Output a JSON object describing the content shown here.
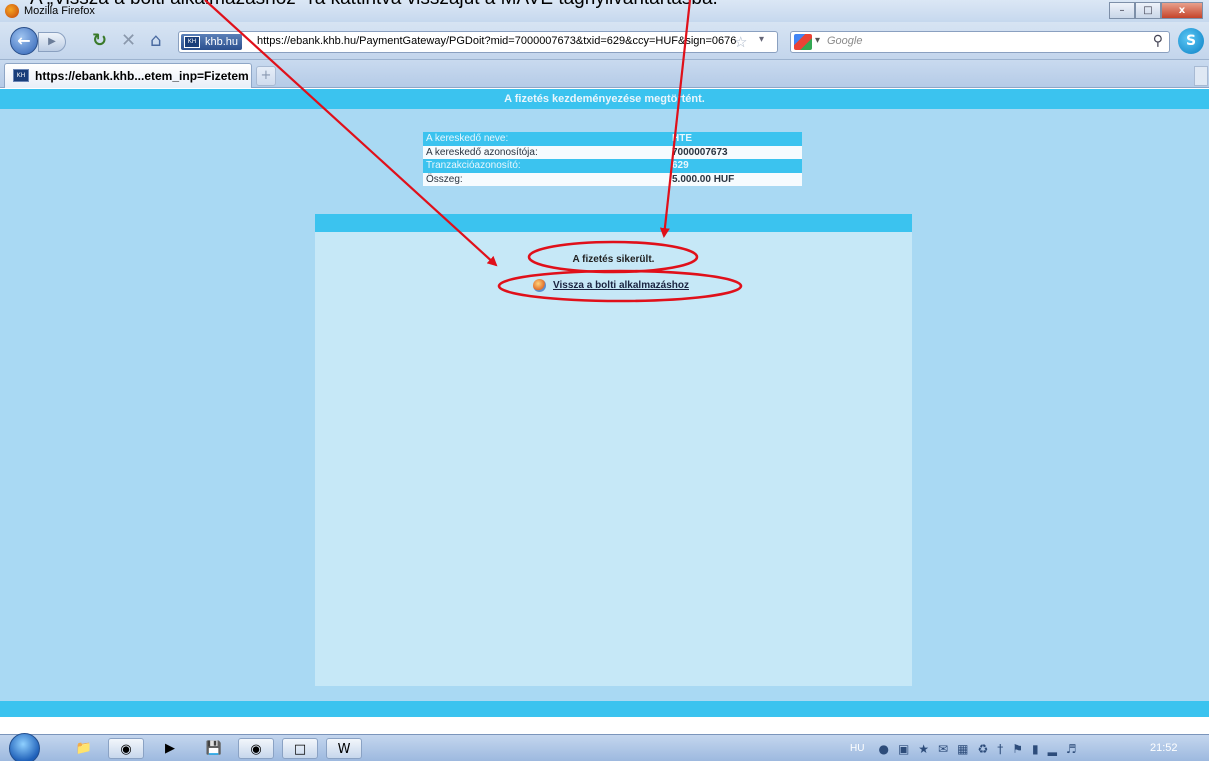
{
  "caption": "A „Vissza a bolti alkalmazáshoz”-ra kattintva visszajút a MAVE tagnyilvántartásba.",
  "window": {
    "title": "Mozilla Firefox",
    "buttons": {
      "minimize": "–",
      "maximize": "□",
      "close": "x"
    }
  },
  "navbar": {
    "site_identity": "khb.hu",
    "url": "https://ebank.khb.hu/PaymentGateway/PGDoit?mid=7000007673&txid=629&ccy=HUF&sign=0676",
    "search_engine": "Google",
    "icons": [
      "back-icon",
      "forward-icon",
      "reload-icon",
      "stop-icon",
      "home-icon",
      "bookmark-star-icon",
      "search-icon",
      "skype-icon"
    ]
  },
  "tabs": [
    {
      "title": "https://ebank.khb...etem_inp=Fizetem",
      "active": true
    }
  ],
  "page": {
    "header": "A fizetés kezdeményezése megtörtént.",
    "info_rows": [
      {
        "label": "A kereskedő neve:",
        "value": "HTE"
      },
      {
        "label": "A kereskedő azonosítója:",
        "value": "7000007673"
      },
      {
        "label": "Tranzakcióazonosító:",
        "value": "629"
      },
      {
        "label": "Összeg:",
        "value": "5.000.00 HUF"
      }
    ],
    "success_message": "A fizetés sikerült.",
    "return_link": "Vissza a bolti alkalmazáshoz"
  },
  "annotation_color": "#e0101a",
  "taskbar": {
    "language": "HU",
    "clock": "21:52",
    "pinned": [
      "explorer-icon",
      "firefox-icon",
      "media-player-icon",
      "save-icon",
      "browser-icon",
      "document-icon",
      "word-icon"
    ]
  }
}
